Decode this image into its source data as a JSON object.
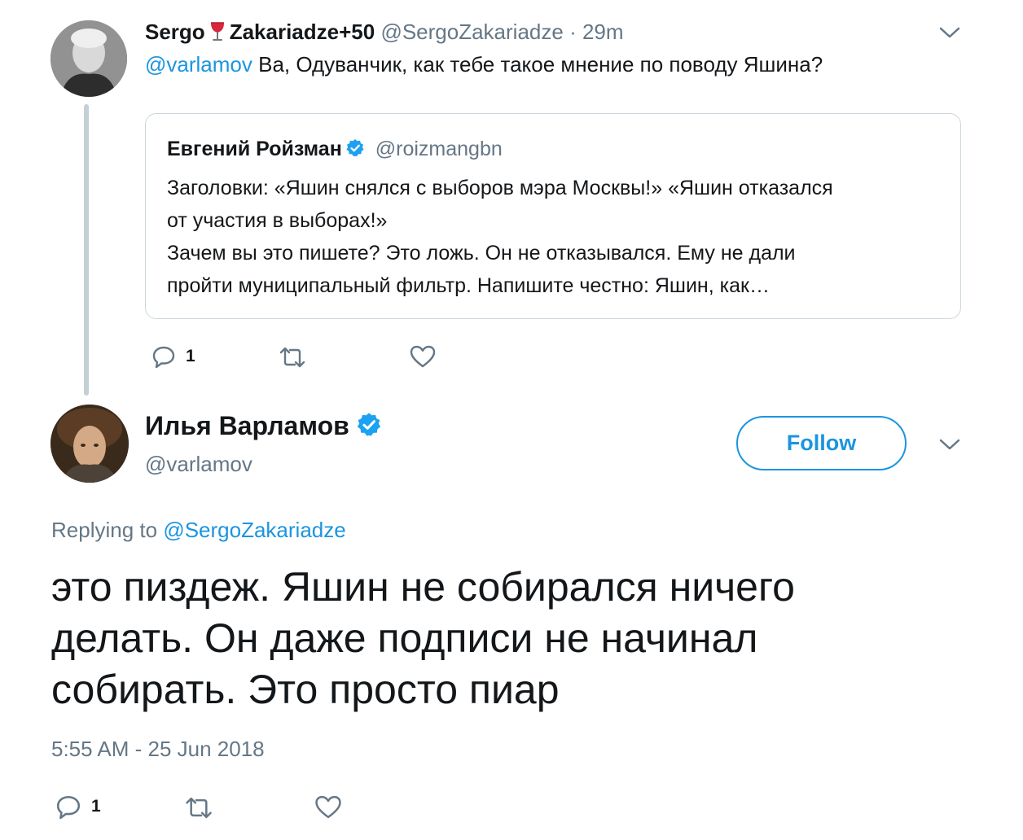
{
  "tweet": {
    "author_name_part1": "Sergo",
    "author_name_part2": "Zakariadze+50",
    "author_handle": "@SergoZakariadze",
    "separator": "·",
    "time": "29m",
    "text_mention": "@varlamov",
    "text": "Ва, Одуванчик, как тебе такое мнение по поводу Яшина?",
    "reply_count": "1",
    "emoji_icon": "wine-glass-icon"
  },
  "quoted_tweet": {
    "author_name": "Евгений Ройзман",
    "author_handle": "@roizmangbn",
    "lines": [
      "Заголовки: «Яшин снялся с выборов мэра Москвы!» «Яшин отказался",
      "от участия в выборах!»",
      "Зачем вы это пишете? Это ложь. Он не отказывался. Ему не дали",
      "пройти муниципальный фильтр. Напишите честно: Яшин, как…"
    ]
  },
  "reply": {
    "author_name": "Илья Варламов",
    "author_handle": "@varlamov",
    "follow_label": "Follow",
    "replying_prefix": "Replying to",
    "replying_handle": "@SergoZakariadze",
    "text_lines": [
      "это пиздеж. Яшин не собирался ничего",
      "делать. Он даже подписи не начинал",
      "собирать. Это просто пиар"
    ],
    "timestamp": "5:55 AM - 25 Jun 2018",
    "reply_count": "1"
  },
  "colors": {
    "accent": "#1b95e0",
    "secondary_text": "#657786",
    "primary_text": "#14171a",
    "border": "#ccd6dd",
    "thread_line": "#c4cfd6"
  }
}
